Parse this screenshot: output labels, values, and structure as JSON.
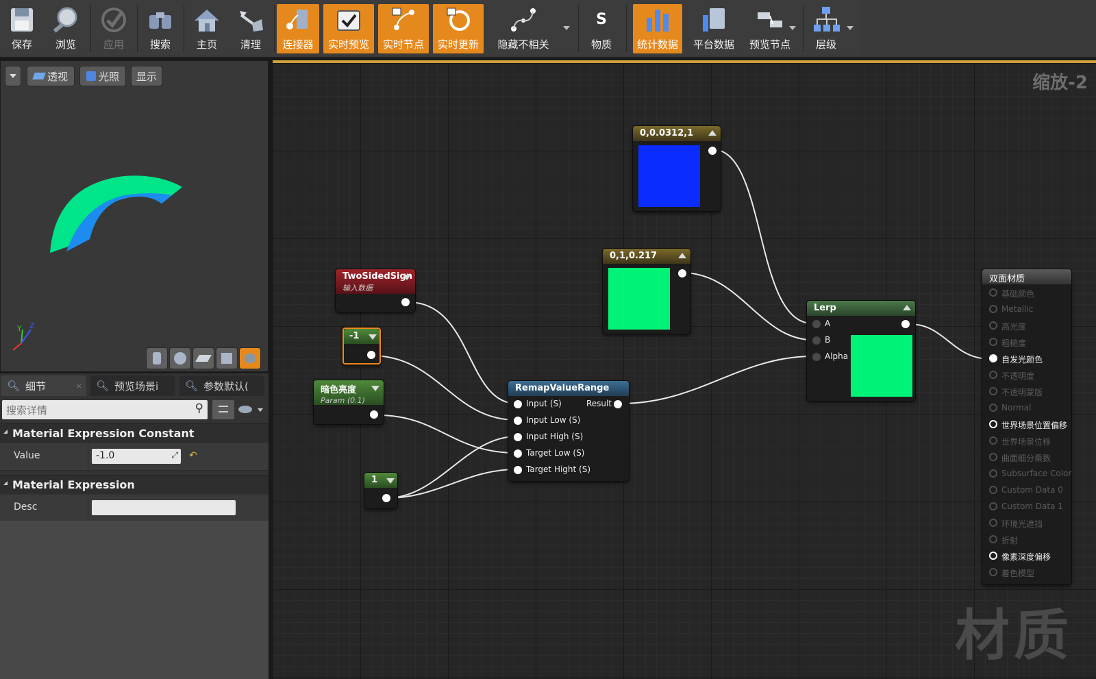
{
  "toolbar": {
    "buttons": [
      {
        "label": "保存",
        "icon": "save-icon"
      },
      {
        "label": "浏览",
        "icon": "browse-icon"
      },
      {
        "label": "应用",
        "icon": "apply-icon"
      },
      {
        "label": "搜索",
        "icon": "search-icon"
      },
      {
        "label": "主页",
        "icon": "home-icon"
      },
      {
        "label": "清理",
        "icon": "clean-icon"
      },
      {
        "label": "连接器",
        "icon": "connector-icon"
      },
      {
        "label": "实时预览",
        "icon": "live-preview-icon"
      },
      {
        "label": "实时节点",
        "icon": "live-nodes-icon"
      },
      {
        "label": "实时更新",
        "icon": "live-update-icon"
      },
      {
        "label": "隐藏不相关",
        "icon": "hide-unrelated-icon"
      },
      {
        "label": "物质",
        "icon": "substance-icon"
      },
      {
        "label": "统计数据",
        "icon": "stats-icon"
      },
      {
        "label": "平台数据",
        "icon": "platform-stats-icon"
      },
      {
        "label": "预览节点",
        "icon": "preview-nodes-icon"
      },
      {
        "label": "层级",
        "icon": "hierarchy-icon"
      }
    ],
    "active_color": "#e6891d"
  },
  "viewport": {
    "buttons": [
      "透视",
      "光照",
      "显示"
    ],
    "axis": {
      "y": "Y",
      "z": "Z"
    },
    "preview_colors": {
      "outer": "#00e58a",
      "inner": "#1c8cf0"
    }
  },
  "details": {
    "tabs": [
      "细节",
      "预览场景i",
      "参数默认("
    ],
    "search_placeholder": "搜索详情",
    "categories": [
      {
        "title": "Material Expression Constant",
        "prop_label": "Value",
        "prop_value": "-1.0"
      },
      {
        "title": "Material Expression",
        "prop_label": "Desc",
        "prop_value": ""
      }
    ]
  },
  "graph": {
    "zoom": "缩放-2",
    "watermark": "材质",
    "nodes": {
      "blue_const": {
        "title": "0,0.0312,1",
        "color": "#0a2cff"
      },
      "green_const": {
        "title": "0,1,0.217",
        "color": "#00f276"
      },
      "two_sided": {
        "title": "TwoSidedSign",
        "subtitle": "输入数据"
      },
      "neg_one": {
        "title": "-1"
      },
      "dark_brightness": {
        "title": "暗色亮度",
        "subtitle": "Param (0.1)"
      },
      "one": {
        "title": "1"
      },
      "remap": {
        "title": "RemapValueRange",
        "inputs": [
          "Input (S)",
          "Input Low (S)",
          "Input High (S)",
          "Target Low (S)",
          "Target Hight (S)"
        ],
        "output": "Result"
      },
      "lerp": {
        "title": "Lerp",
        "inputs": [
          "A",
          "B",
          "Alpha"
        ],
        "preview_color": "#00f276"
      },
      "material": {
        "title": "双面材质",
        "pins": [
          {
            "label": "基础颜色",
            "on": false
          },
          {
            "label": "Metallic",
            "on": false
          },
          {
            "label": "高光度",
            "on": false
          },
          {
            "label": "粗糙度",
            "on": false
          },
          {
            "label": "自发光颜色",
            "on": true
          },
          {
            "label": "不透明度",
            "on": false
          },
          {
            "label": "不透明蒙版",
            "on": false
          },
          {
            "label": "Normal",
            "on": false
          },
          {
            "label": "世界场景位置偏移",
            "on": true
          },
          {
            "label": "世界场景位移",
            "on": false
          },
          {
            "label": "曲面细分乘数",
            "on": false
          },
          {
            "label": "Subsurface Color",
            "on": false
          },
          {
            "label": "Custom Data 0",
            "on": false
          },
          {
            "label": "Custom Data 1",
            "on": false
          },
          {
            "label": "环境光遮挡",
            "on": false
          },
          {
            "label": "折射",
            "on": false
          },
          {
            "label": "像素深度偏移",
            "on": true
          },
          {
            "label": "着色模型",
            "on": false
          }
        ]
      }
    }
  }
}
